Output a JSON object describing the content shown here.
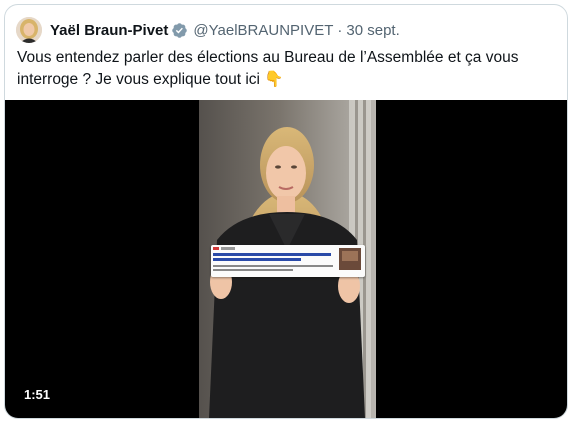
{
  "tweet": {
    "author_name": "Yaël Braun-Pivet",
    "handle": "@YaelBRAUNPIVET",
    "separator": "·",
    "date": "30 sept.",
    "text": "Vous entendez parler des élections au Bureau de l’Assemblée et ça vous interroge ? Je vous explique tout ici 👇"
  },
  "video": {
    "duration": "1:51"
  },
  "colors": {
    "text_primary": "#0f1419",
    "text_secondary": "#536471",
    "verified_badge": "#829aab",
    "border": "#cfd9de"
  },
  "icons": {
    "verified": "verified-badge-icon"
  }
}
